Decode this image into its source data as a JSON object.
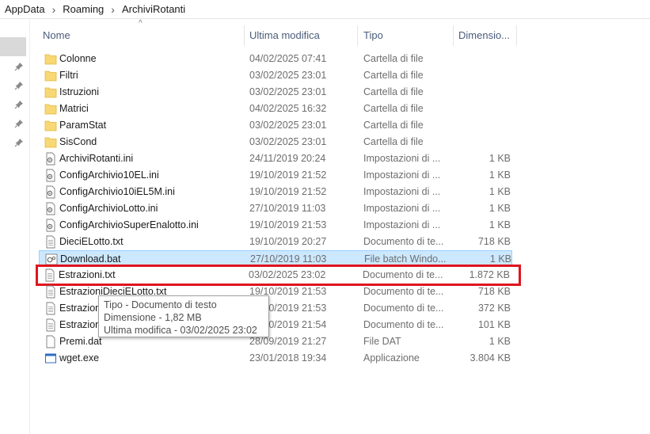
{
  "breadcrumb": [
    "AppData",
    "Roaming",
    "ArchiviRotanti"
  ],
  "columns": {
    "name": "Nome",
    "modified": "Ultima modifica",
    "type": "Tipo",
    "size": "Dimensio..."
  },
  "files": [
    {
      "name": "Colonne",
      "date": "04/02/2025 07:41",
      "type": "Cartella di file",
      "size": "",
      "icon": "folder-icon"
    },
    {
      "name": "Filtri",
      "date": "03/02/2025 23:01",
      "type": "Cartella di file",
      "size": "",
      "icon": "folder-icon"
    },
    {
      "name": "Istruzioni",
      "date": "03/02/2025 23:01",
      "type": "Cartella di file",
      "size": "",
      "icon": "folder-icon"
    },
    {
      "name": "Matrici",
      "date": "04/02/2025 16:32",
      "type": "Cartella di file",
      "size": "",
      "icon": "folder-icon"
    },
    {
      "name": "ParamStat",
      "date": "03/02/2025 23:01",
      "type": "Cartella di file",
      "size": "",
      "icon": "folder-icon"
    },
    {
      "name": "SisCond",
      "date": "03/02/2025 23:01",
      "type": "Cartella di file",
      "size": "",
      "icon": "folder-icon"
    },
    {
      "name": "ArchiviRotanti.ini",
      "date": "24/11/2019 20:24",
      "type": "Impostazioni di ...",
      "size": "1 KB",
      "icon": "ini-file-icon"
    },
    {
      "name": "ConfigArchivio10EL.ini",
      "date": "19/10/2019 21:52",
      "type": "Impostazioni di ...",
      "size": "1 KB",
      "icon": "ini-file-icon"
    },
    {
      "name": "ConfigArchivio10iEL5M.ini",
      "date": "19/10/2019 21:52",
      "type": "Impostazioni di ...",
      "size": "1 KB",
      "icon": "ini-file-icon"
    },
    {
      "name": "ConfigArchivioLotto.ini",
      "date": "27/10/2019 11:03",
      "type": "Impostazioni di ...",
      "size": "1 KB",
      "icon": "ini-file-icon"
    },
    {
      "name": "ConfigArchivioSuperEnalotto.ini",
      "date": "19/10/2019 21:53",
      "type": "Impostazioni di ...",
      "size": "1 KB",
      "icon": "ini-file-icon"
    },
    {
      "name": "DieciELotto.txt",
      "date": "19/10/2019 20:27",
      "type": "Documento di te...",
      "size": "718 KB",
      "icon": "text-file-icon"
    },
    {
      "name": "Download.bat",
      "date": "27/10/2019 11:03",
      "type": "File batch Windo...",
      "size": "1 KB",
      "icon": "batch-file-icon"
    },
    {
      "name": "Estrazioni.txt",
      "date": "03/02/2025 23:02",
      "type": "Documento di te...",
      "size": "1.872 KB",
      "icon": "text-file-icon"
    },
    {
      "name": "EstrazioniDieciELotto.txt",
      "date": "19/10/2019 21:53",
      "type": "Documento di te...",
      "size": "718 KB",
      "icon": "text-file-icon"
    },
    {
      "name": "Estrazioni",
      "date": "19/10/2019 21:53",
      "type": "Documento di te...",
      "size": "372 KB",
      "icon": "text-file-icon"
    },
    {
      "name": "Estrazioni",
      "date": "19/10/2019 21:54",
      "type": "Documento di te...",
      "size": "101 KB",
      "icon": "text-file-icon"
    },
    {
      "name": "Premi.dat",
      "date": "28/09/2019 21:27",
      "type": "File DAT",
      "size": "1 KB",
      "icon": "data-file-icon"
    },
    {
      "name": "wget.exe",
      "date": "23/01/2018 19:34",
      "type": "Applicazione",
      "size": "3.804 KB",
      "icon": "exe-file-icon"
    }
  ],
  "selected_row": "Download.bat",
  "highlighted_row": "Estrazioni.txt",
  "tooltip": {
    "type_line": "Tipo - Documento di testo",
    "size_line": "Dimensione - 1,82 MB",
    "modified_line": "Ultima modifica - 03/02/2025 23:02"
  },
  "colors": {
    "selection_bg": "#cce8ff",
    "selection_border": "#99d1ff",
    "highlight_box": "#e0141e",
    "folder": "#f8d775",
    "header_text": "#4a5c7a"
  }
}
